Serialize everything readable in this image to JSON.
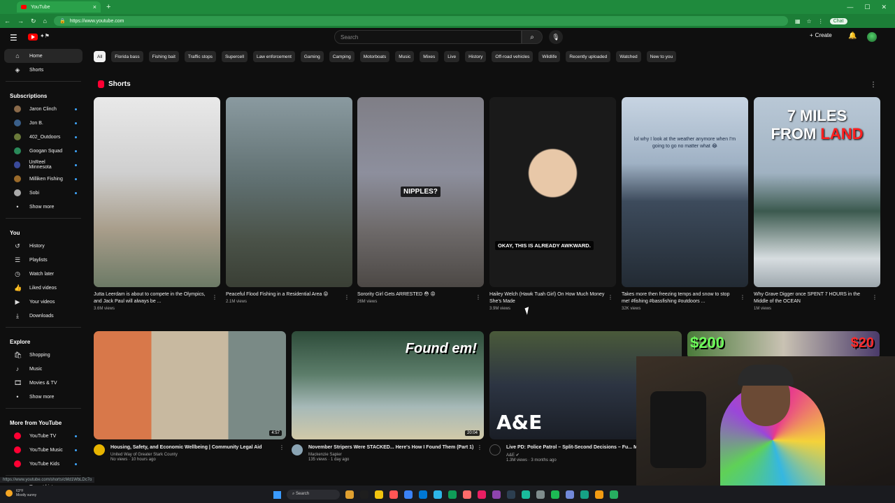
{
  "browser": {
    "tab_title": "YouTube",
    "url": "https://www.youtube.com",
    "chat_label": "Chat",
    "status_url": "https://www.youtube.com/shorts/cMd1WbLDc7o"
  },
  "header": {
    "search_placeholder": "Search",
    "create_label": "Create"
  },
  "sidebar": {
    "main": [
      {
        "label": "Home",
        "icon": "home-icon",
        "active": true
      },
      {
        "label": "Shorts",
        "icon": "shorts-icon"
      }
    ],
    "subscriptions_title": "Subscriptions",
    "subscriptions": [
      {
        "label": "Jaron Clinch",
        "color": "#8a6a4a"
      },
      {
        "label": "Jon B.",
        "color": "#3a5f8a"
      },
      {
        "label": "402_Outdoors",
        "color": "#6a7a3a"
      },
      {
        "label": "Googan Squad",
        "color": "#2a8a5a"
      },
      {
        "label": "UnReel Minnesota",
        "color": "#3a4a9a"
      },
      {
        "label": "Milliken Fishing",
        "color": "#9a6a2a"
      },
      {
        "label": "Sobi",
        "color": "#aaaaaa"
      }
    ],
    "show_more": "Show more",
    "you_title": "You",
    "you": [
      {
        "label": "History",
        "icon": "history-icon"
      },
      {
        "label": "Playlists",
        "icon": "playlists-icon"
      },
      {
        "label": "Watch later",
        "icon": "clock-icon"
      },
      {
        "label": "Liked videos",
        "icon": "thumbs-up-icon"
      },
      {
        "label": "Your videos",
        "icon": "video-icon"
      },
      {
        "label": "Downloads",
        "icon": "download-icon"
      }
    ],
    "explore_title": "Explore",
    "explore": [
      {
        "label": "Shopping",
        "icon": "bag-icon"
      },
      {
        "label": "Music",
        "icon": "music-icon"
      },
      {
        "label": "Movies & TV",
        "icon": "film-icon"
      }
    ],
    "show_more_2": "Show more",
    "more_title": "More from YouTube",
    "more": [
      {
        "label": "YouTube TV"
      },
      {
        "label": "YouTube Music"
      },
      {
        "label": "YouTube Kids"
      }
    ],
    "report": "Report history"
  },
  "chips": [
    "All",
    "Florida bass",
    "Fishing bait",
    "Traffic stops",
    "Supercell",
    "Law enforcement",
    "Gaming",
    "Camping",
    "Motorboats",
    "Music",
    "Mixes",
    "Live",
    "History",
    "Off-road vehicles",
    "Wildlife",
    "Recently uploaded",
    "Watched",
    "New to you"
  ],
  "shorts": {
    "title": "Shorts",
    "items": [
      {
        "title": "Jutta Leerdam is about to compete in the Olympics, and Jack Paul will always be ...",
        "views": "3.6M views"
      },
      {
        "title": "Peaceful Flood Fishing in a Residential Area 😝",
        "views": "2.1M views"
      },
      {
        "title": "Sorority Girl Gets ARRESTED 😳 😡",
        "views": "26M views",
        "caption": "NIPPLES?"
      },
      {
        "title": "Hailey Welch (Hawk Tuah Girl) On How Much Money She's Made",
        "views": "3.9M views",
        "caption": "OKAY, THIS IS ALREADY AWKWARD."
      },
      {
        "title": "Takes more then freezing temps and snow to stop me! #fishing #bassfishing #outdoors ...",
        "views": "32K views",
        "caption": "lol why I look at the weather anymore when I'm going to go no matter what 😂"
      },
      {
        "title": "Why Grave Digger once SPENT 7 HOURS in the Middle of the OCEAN",
        "views": "1M views",
        "caption_a": "7 MILES",
        "caption_b": "FROM ",
        "caption_c": "LAND"
      }
    ]
  },
  "videos": [
    {
      "title": "Housing, Safety, and Economic Wellbeing | Community Legal Aid",
      "channel": "United Way of Greater Stark County",
      "stats": "No views · 10 hours ago",
      "duration": "4:57"
    },
    {
      "title": "November Stripers Were STACKED... Here's How I Found Them (Part 1)",
      "channel": "Mackenzie Sapier",
      "stats": "135 views · 1 day ago",
      "duration": "20:04",
      "caption": "Found em!"
    },
    {
      "title": "Live PD: Police Patrol – Split-Second Decisions – Fu... MARATHON | A&E",
      "channel": "A&E ✔",
      "stats": "1.3M views · 3 months ago",
      "caption": "A&E"
    },
    {
      "title": "",
      "caption_a": "$200",
      "caption_b": "$20"
    }
  ],
  "taskbar": {
    "temp": "63°F",
    "weather": "Mostly sunny",
    "search": "Search"
  }
}
